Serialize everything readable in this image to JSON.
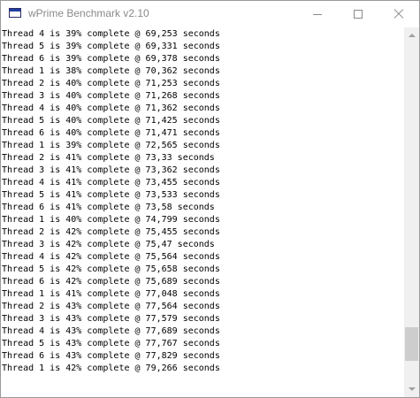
{
  "window": {
    "title": "wPrime Benchmark v2.10",
    "icon": "app-window-icon"
  },
  "controls": {
    "minimize_icon": "minimize-icon",
    "maximize_icon": "maximize-icon",
    "close_icon": "close-icon"
  },
  "log": {
    "lines": [
      "Thread 4 is 39% complete @ 69,253 seconds",
      "Thread 5 is 39% complete @ 69,331 seconds",
      "Thread 6 is 39% complete @ 69,378 seconds",
      "Thread 1 is 38% complete @ 70,362 seconds",
      "Thread 2 is 40% complete @ 71,253 seconds",
      "Thread 3 is 40% complete @ 71,268 seconds",
      "Thread 4 is 40% complete @ 71,362 seconds",
      "Thread 5 is 40% complete @ 71,425 seconds",
      "Thread 6 is 40% complete @ 71,471 seconds",
      "Thread 1 is 39% complete @ 72,565 seconds",
      "Thread 2 is 41% complete @ 73,33 seconds",
      "Thread 3 is 41% complete @ 73,362 seconds",
      "Thread 4 is 41% complete @ 73,455 seconds",
      "Thread 5 is 41% complete @ 73,533 seconds",
      "Thread 6 is 41% complete @ 73,58 seconds",
      "Thread 1 is 40% complete @ 74,799 seconds",
      "Thread 2 is 42% complete @ 75,455 seconds",
      "Thread 3 is 42% complete @ 75,47 seconds",
      "Thread 4 is 42% complete @ 75,564 seconds",
      "Thread 5 is 42% complete @ 75,658 seconds",
      "Thread 6 is 42% complete @ 75,689 seconds",
      "Thread 1 is 41% complete @ 77,048 seconds",
      "Thread 2 is 43% complete @ 77,564 seconds",
      "Thread 3 is 43% complete @ 77,579 seconds",
      "Thread 4 is 43% complete @ 77,689 seconds",
      "Thread 5 is 43% complete @ 77,767 seconds",
      "Thread 6 is 43% complete @ 77,829 seconds",
      "Thread 1 is 42% complete @ 79,266 seconds"
    ]
  },
  "scrollbar": {
    "position": 0.93,
    "up_icon": "scroll-up-arrow-icon",
    "down_icon": "scroll-down-arrow-icon"
  }
}
